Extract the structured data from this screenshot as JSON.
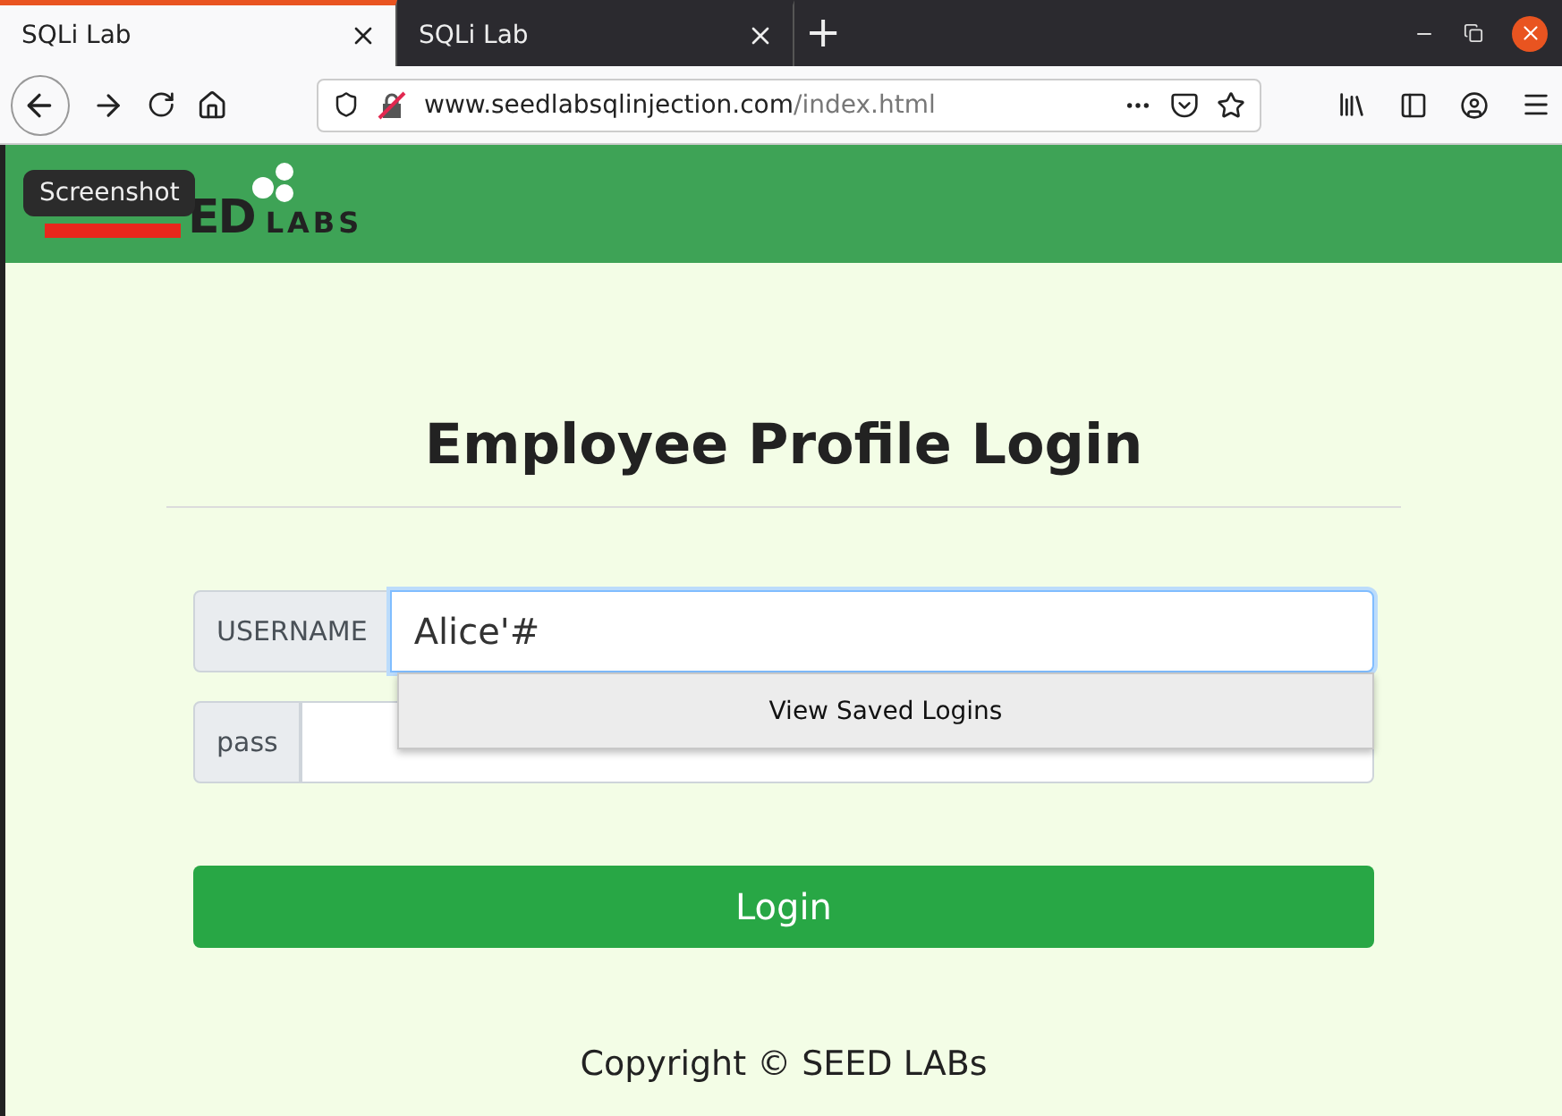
{
  "tabs": [
    {
      "title": "SQLi Lab",
      "selected": true
    },
    {
      "title": "SQLi Lab",
      "selected": false
    }
  ],
  "new_tab": "+",
  "address_bar": {
    "domain": "www.seedlabsqlinjection.com",
    "path": "/index.html"
  },
  "logo": {
    "shown": "ED",
    "sub": "LABS"
  },
  "tooltip": "Screenshot",
  "title": "Employee Profile Login",
  "fields": [
    {
      "label": "USERNAME",
      "value": "Alice'#",
      "focused": true
    },
    {
      "label": "pass",
      "focused": false
    }
  ],
  "autocomplete": "View Saved Logins",
  "login_button": "Login",
  "footer": "Copyright © SEED LABs"
}
